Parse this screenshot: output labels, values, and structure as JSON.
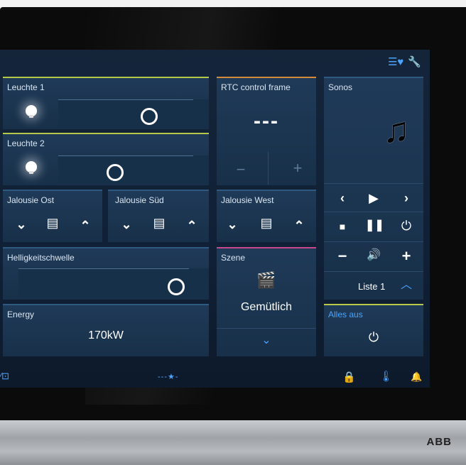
{
  "brand": "ABB",
  "tiles": {
    "leuchte1": {
      "label": "Leuchte 1",
      "level": 0.6
    },
    "leuchte2": {
      "label": "Leuchte 2",
      "level": 0.35
    },
    "rtc": {
      "label": "RTC control frame",
      "value": "---",
      "minus": "−",
      "plus": "+"
    },
    "sonos": {
      "label": "Sonos",
      "list_label": "Liste 1"
    },
    "jalousie_ost": {
      "label": "Jalousie Ost"
    },
    "jalousie_sued": {
      "label": "Jalousie Süd"
    },
    "jalousie_west": {
      "label": "Jalousie West"
    },
    "helligkeit": {
      "label": "Helligkeitschwelle",
      "level": 0.85
    },
    "szene": {
      "label": "Szene",
      "value": "Gemütlich"
    },
    "energy": {
      "label": "Energy",
      "value": "170kW"
    },
    "alles_aus": {
      "label": "Alles aus"
    }
  },
  "statusbar": {
    "page_indicator": "---★-"
  },
  "colors": {
    "accent": "#3d8fe0",
    "tile": "#1f3a58",
    "green_bar": "#b6c848",
    "orange_bar": "#d48a3c",
    "pink_bar": "#c8478d"
  }
}
